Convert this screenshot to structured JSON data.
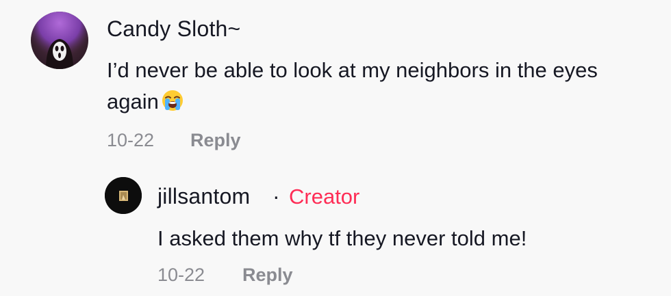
{
  "comments": [
    {
      "username": "Candy Sloth~",
      "avatar": "scream-mask-avatar",
      "text": "I’d never be able to look at my neighbors in the eyes again",
      "emoji": "loudly-crying-face-icon",
      "date": "10-22",
      "reply_label": "Reply"
    }
  ],
  "reply": {
    "username": "jillsantom",
    "separator": "·",
    "badge": "Creator",
    "avatar": "framed-photo-avatar",
    "text": "I asked them why tf they never told me!",
    "date": "10-22",
    "reply_label": "Reply"
  },
  "colors": {
    "background": "#f8f8f8",
    "text": "#161823",
    "meta": "#8a8b91",
    "creator_badge": "#fe2c55"
  }
}
